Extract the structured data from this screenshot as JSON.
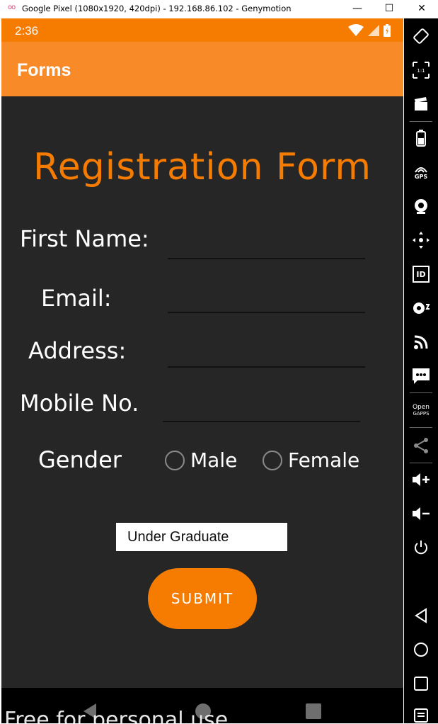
{
  "window": {
    "title": "Google Pixel (1080x1920, 420dpi) - 192.168.86.102 - Genymotion",
    "logo": "oo",
    "minimize": "—",
    "maximize": "☐",
    "close": "✕"
  },
  "status_bar": {
    "time": "2:36"
  },
  "app_bar": {
    "title": "Forms"
  },
  "form": {
    "heading": "Registration Form",
    "first_name_label": "First Name:",
    "email_label": "Email:",
    "address_label": "Address:",
    "mobile_label": "Mobile No.",
    "gender_label": "Gender",
    "gender_options": [
      "Male",
      "Female"
    ],
    "education_selected": "Under Graduate",
    "submit_label": "SUBMIT"
  },
  "watermark": "Free for personal use",
  "sidebar": {
    "open_gapps_line1": "Open",
    "open_gapps_line2": "GAPPS",
    "gps_label": "GPS",
    "id_label": "ID",
    "pixel_label": "1:1"
  },
  "colors": {
    "accent": "#f57c00",
    "app_bar": "#f98a28",
    "background": "#262626"
  }
}
